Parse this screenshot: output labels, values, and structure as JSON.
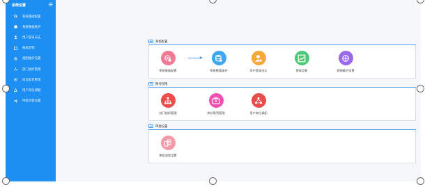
{
  "sidebar": {
    "title": "系统设置",
    "menu_icon": "menu-icon",
    "items": [
      {
        "label": "系统基础配置",
        "icon": "search-icon"
      },
      {
        "label": "系统数据维护",
        "icon": "database-icon"
      },
      {
        "label": "用户登录日志",
        "icon": "user-icon"
      },
      {
        "label": "报表定制",
        "icon": "report-icon"
      },
      {
        "label": "视图维护设置",
        "icon": "view-icon"
      },
      {
        "label": "部门组织管理",
        "icon": "org-icon"
      },
      {
        "label": "岗位职责管理",
        "icon": "post-icon"
      },
      {
        "label": "用户岗位调配",
        "icon": "user-assign-icon"
      },
      {
        "label": "审批流程设置",
        "icon": "flow-icon"
      }
    ]
  },
  "sections": [
    {
      "title": "系统配置",
      "tiles": [
        {
          "label": "系统基础配置",
          "icon": "gear-icon",
          "color": "#f27a94"
        },
        {
          "label": "系统数据维护",
          "icon": "database-icon",
          "color": "#3fa7ee"
        },
        {
          "label": "用户登录日志",
          "icon": "user-log-icon",
          "color": "#f6a93b"
        },
        {
          "label": "报表定制",
          "icon": "chart-report-icon",
          "color": "#4cc776"
        },
        {
          "label": "视图维护设置",
          "icon": "view-settings-icon",
          "color": "#9b6ae8"
        }
      ]
    },
    {
      "title": "账号权限",
      "tiles": [
        {
          "label": "部门组织管理",
          "icon": "org-chart-icon",
          "color": "#ee4b4b"
        },
        {
          "label": "岗位职责管理",
          "icon": "post-duty-icon",
          "color": "#f24fb2"
        },
        {
          "label": "用户岗位调配",
          "icon": "user-assign-icon",
          "color": "#ea4c4c"
        }
      ]
    },
    {
      "title": "审批设置",
      "tiles": [
        {
          "label": "审批流程设置",
          "icon": "approval-flow-icon",
          "color": "#f49aa8"
        }
      ]
    }
  ],
  "colors": {
    "sidebar_bg": "#1d8ff3",
    "accent": "#4b9df4",
    "main_bg": "#f5f7fa"
  }
}
